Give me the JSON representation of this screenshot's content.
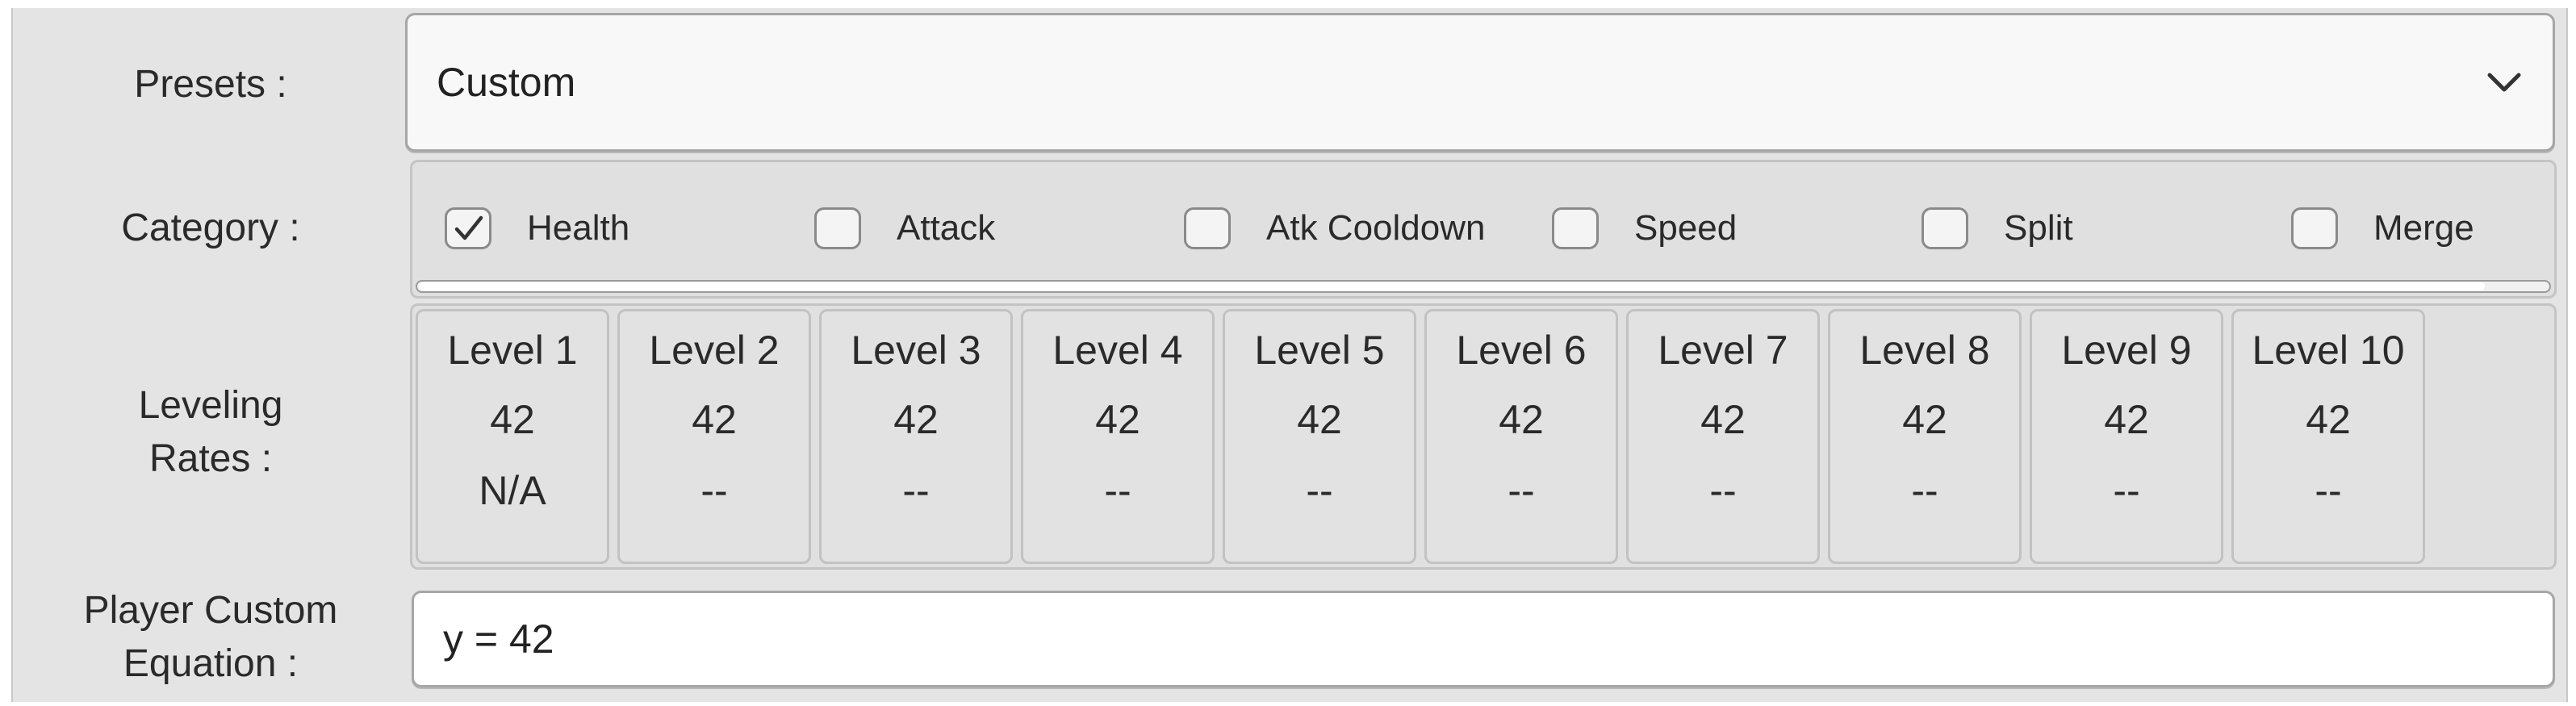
{
  "presets": {
    "label": "Presets :",
    "selected": "Custom"
  },
  "category": {
    "label": "Category :",
    "items": [
      {
        "label": "Health",
        "checked": true
      },
      {
        "label": "Attack",
        "checked": false
      },
      {
        "label": "Atk Cooldown",
        "checked": false
      },
      {
        "label": "Speed",
        "checked": false
      },
      {
        "label": "Split",
        "checked": false
      },
      {
        "label": "Merge",
        "checked": false
      }
    ]
  },
  "leveling": {
    "label_line1": "Leveling",
    "label_line2": "Rates :",
    "levels": [
      {
        "name": "Level 1",
        "value": "42",
        "extra": "N/A"
      },
      {
        "name": "Level 2",
        "value": "42",
        "extra": "--"
      },
      {
        "name": "Level 3",
        "value": "42",
        "extra": "--"
      },
      {
        "name": "Level 4",
        "value": "42",
        "extra": "--"
      },
      {
        "name": "Level 5",
        "value": "42",
        "extra": "--"
      },
      {
        "name": "Level 6",
        "value": "42",
        "extra": "--"
      },
      {
        "name": "Level 7",
        "value": "42",
        "extra": "--"
      },
      {
        "name": "Level 8",
        "value": "42",
        "extra": "--"
      },
      {
        "name": "Level 9",
        "value": "42",
        "extra": "--"
      },
      {
        "name": "Level 10",
        "value": "42",
        "extra": "--"
      }
    ]
  },
  "equation": {
    "label_line1": "Player Custom",
    "label_line2": "Equation :",
    "value": "y = 42"
  },
  "icons": {
    "dropdown": "chevron-down-icon",
    "checked": "checkmark-icon"
  }
}
